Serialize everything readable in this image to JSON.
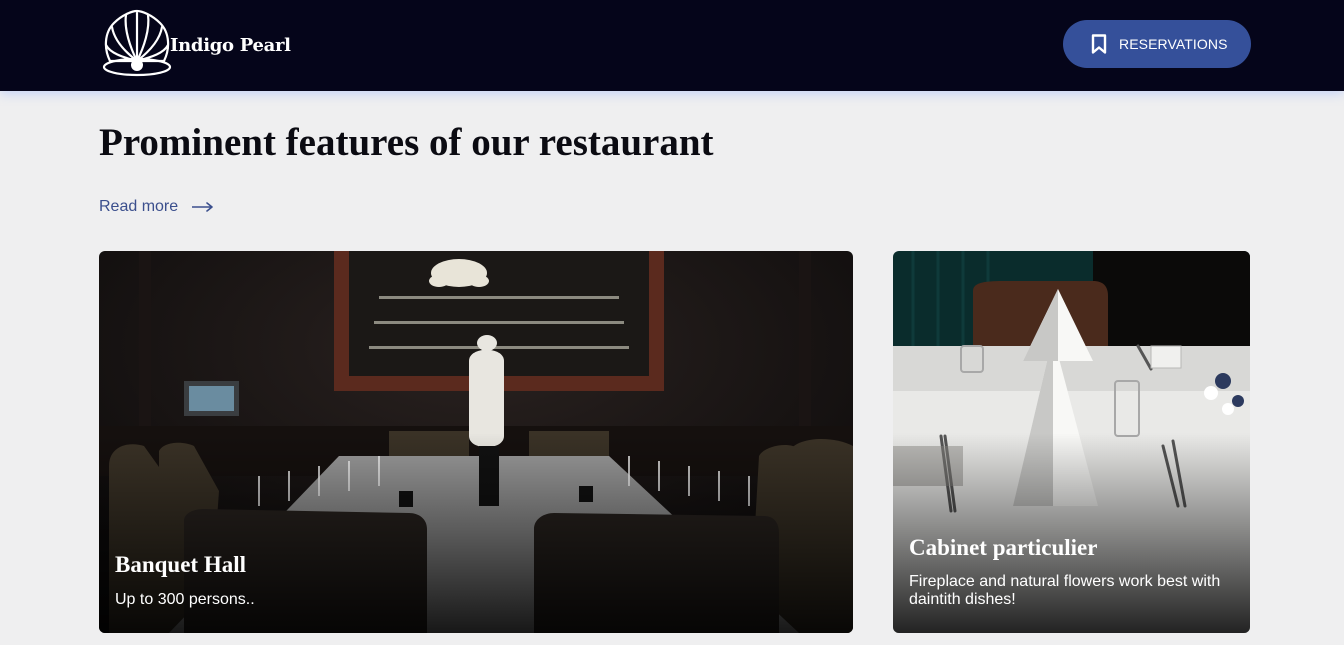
{
  "header": {
    "brand": "Indigo Pearl",
    "reservations_label": "RESERVATIONS",
    "logo_icon": "pearl-shell-icon",
    "reservations_icon": "bookmark-icon"
  },
  "main": {
    "title": "Prominent features of our restaurant",
    "read_more_label": "Read more",
    "read_more_icon": "arrow-right-icon"
  },
  "cards": [
    {
      "title": "Banquet Hall",
      "text": "Up to 300 persons.."
    },
    {
      "title": "Cabinet particulier",
      "text": "Fireplace and natural flowers work best with daintith dishes!"
    }
  ],
  "colors": {
    "header_bg": "#05051a",
    "accent": "#35509a",
    "link": "#3b4f8d",
    "page_bg": "#efeff0"
  }
}
